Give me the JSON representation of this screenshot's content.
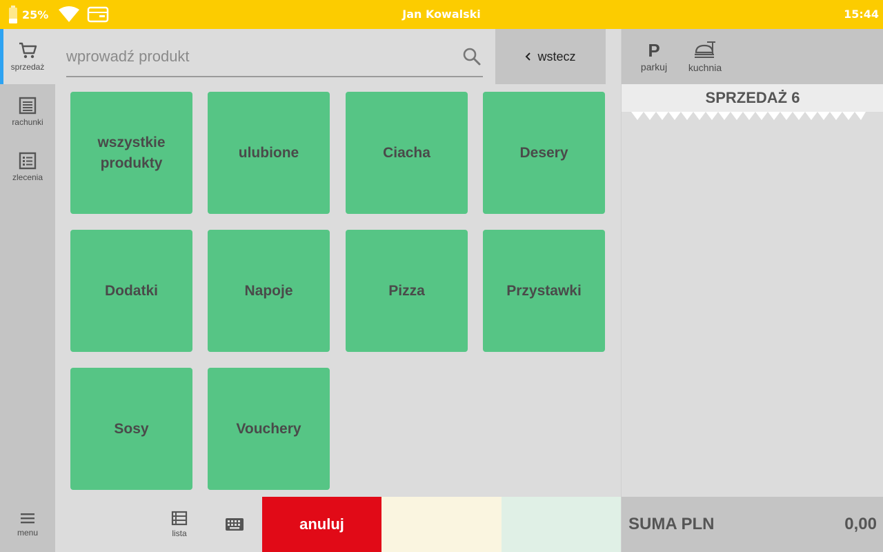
{
  "status_bar": {
    "battery_percent": "25%",
    "user_name": "Jan Kowalski",
    "time": "15:44",
    "icons": [
      "battery-icon",
      "wifi-icon",
      "card-icon"
    ]
  },
  "nav": {
    "items": [
      {
        "label": "sprzedaż",
        "icon": "cart-icon",
        "active": true
      },
      {
        "label": "rachunki",
        "icon": "receipt-icon",
        "active": false
      },
      {
        "label": "zlecenia",
        "icon": "list-icon",
        "active": false
      }
    ],
    "menu_label": "menu"
  },
  "search": {
    "placeholder": "wprowadź produkt",
    "value": ""
  },
  "back_button": {
    "label": "wstecz"
  },
  "categories": [
    {
      "label": "wszystkie produkty"
    },
    {
      "label": "ulubione"
    },
    {
      "label": "Ciacha"
    },
    {
      "label": "Desery"
    },
    {
      "label": "Dodatki"
    },
    {
      "label": "Napoje"
    },
    {
      "label": "Pizza"
    },
    {
      "label": "Przystawki"
    },
    {
      "label": "Sosy"
    },
    {
      "label": "Vouchery"
    }
  ],
  "bottom_toolbar": {
    "list_label": "lista",
    "cancel_label": "anuluj"
  },
  "right_panel": {
    "park_label": "parkuj",
    "park_glyph": "P",
    "kitchen_label": "kuchnia",
    "sale_title": "SPRZEDAŻ 6",
    "sum_label": "SUMA PLN",
    "sum_value": "0,00"
  },
  "colors": {
    "status_bar": "#fccc00",
    "tile": "#56c585",
    "cancel": "#e10a17",
    "active_nav_accent": "#2ea3f2"
  }
}
